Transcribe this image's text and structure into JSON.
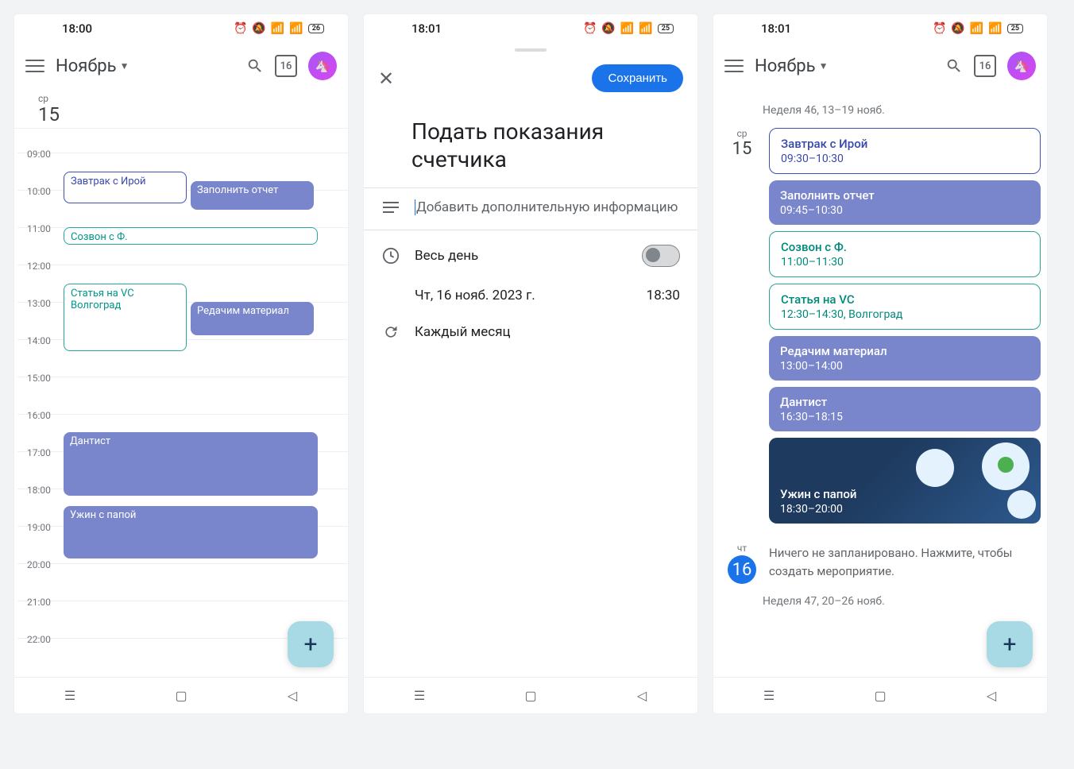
{
  "phone1": {
    "time": "18:00",
    "battery": "26",
    "month": "Ноябрь",
    "today_num": "16",
    "day_wd": "ср",
    "day_dn": "15",
    "hours": [
      "09:00",
      "10:00",
      "11:00",
      "12:00",
      "13:00",
      "14:00",
      "15:00",
      "16:00",
      "17:00",
      "18:00",
      "19:00",
      "20:00",
      "21:00",
      "22:00"
    ],
    "events": {
      "e1": "Завтрак с Ирой",
      "e2": "Заполнить отчет",
      "e3": "Созвон с Ф.",
      "e4_l1": "Статья на VC",
      "e4_l2": "Волгоград",
      "e5": "Редачим материал",
      "e6": "Дантист",
      "e7": "Ужин с папой"
    }
  },
  "phone2": {
    "time": "18:01",
    "battery": "25",
    "save": "Сохранить",
    "title": "Подать показания счетчика",
    "desc_placeholder": "Добавить дополнительную информацию",
    "allday": "Весь день",
    "date": "Чт, 16 нояб. 2023 г.",
    "event_time": "18:30",
    "repeat": "Каждый месяц"
  },
  "phone3": {
    "time": "18:01",
    "battery": "25",
    "month": "Ноябрь",
    "today_num": "16",
    "week1": "Неделя 46, 13–19 нояб.",
    "day1_wd": "ср",
    "day1_dn": "15",
    "cards": {
      "c1_t": "Завтрак с Ирой",
      "c1_s": "09:30–10:30",
      "c2_t": "Заполнить отчет",
      "c2_s": "09:45–10:30",
      "c3_t": "Созвон с Ф.",
      "c3_s": "11:00–11:30",
      "c4_t": "Статья на VC",
      "c4_s": "12:30–14:30, Волгоград",
      "c5_t": "Редачим материал",
      "c5_s": "13:00–14:00",
      "c6_t": "Дантист",
      "c6_s": "16:30–18:15",
      "c7_t": "Ужин с папой",
      "c7_s": "18:30–20:00"
    },
    "day2_wd": "чт",
    "day2_dn": "16",
    "empty": "Ничего не запланировано. Нажмите, чтобы создать мероприятие.",
    "week2": "Неделя 47, 20–26 нояб."
  }
}
